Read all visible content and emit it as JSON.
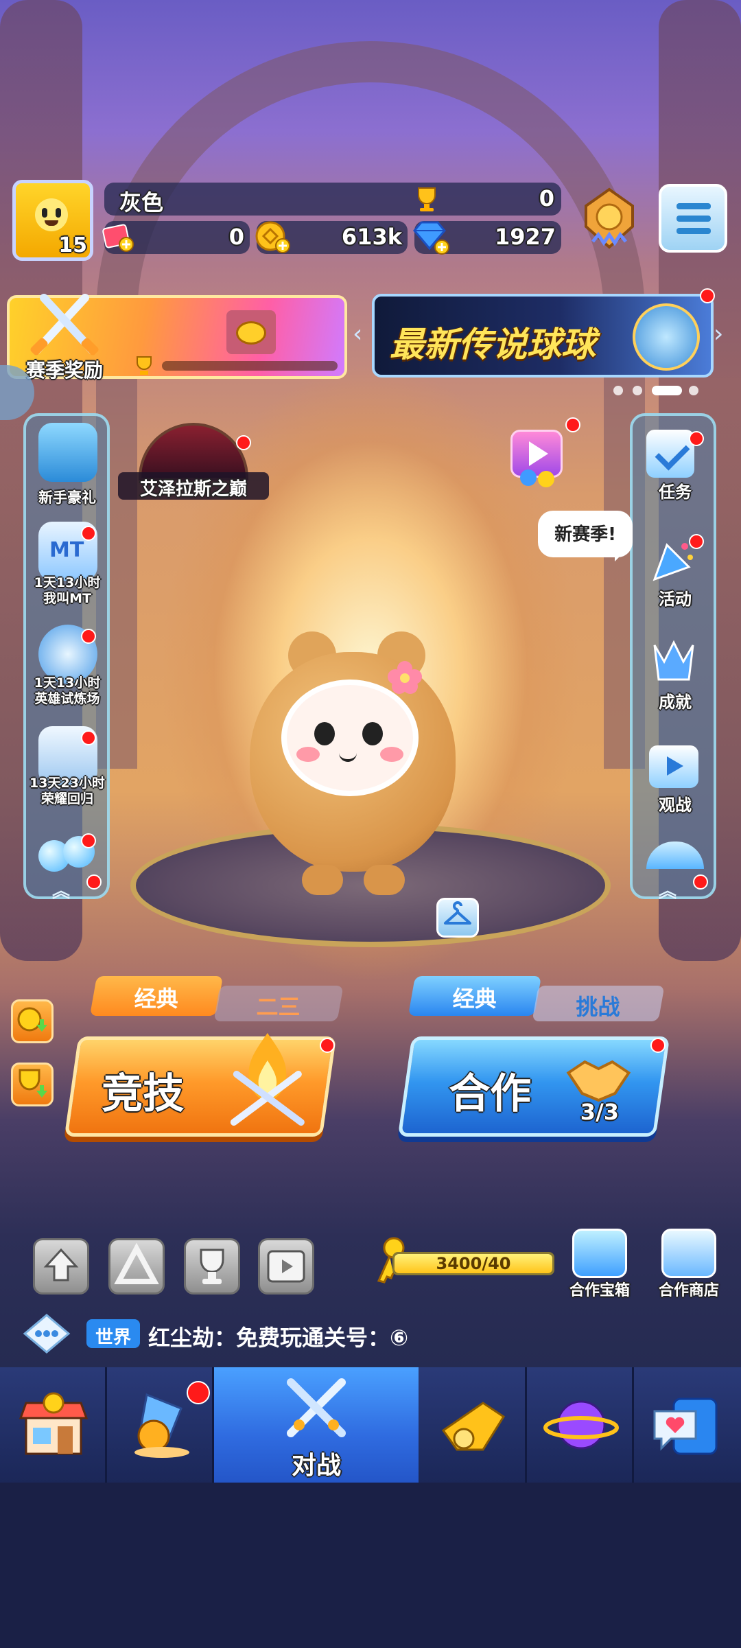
{
  "player": {
    "name": "灰色",
    "level": "15",
    "trophies": "0",
    "tickets": "0",
    "coins": "613k",
    "gems": "1927"
  },
  "banners": {
    "season_reward_label": "赛季奖励",
    "promo_title": "最新传说球球"
  },
  "left_menu": [
    {
      "label": "新手豪礼",
      "icon": "lotus-icon"
    },
    {
      "label": "1天13小时\n我叫MT",
      "icon": "mt-book-icon"
    },
    {
      "label": "1天13小时\n英雄试炼场",
      "icon": "hero-star-icon"
    },
    {
      "label": "13天23小时\n荣耀回归",
      "icon": "glory-chest-icon"
    },
    {
      "label": "",
      "icon": "bubbles-icon"
    }
  ],
  "right_menu": [
    {
      "label": "任务",
      "icon": "task-check-icon"
    },
    {
      "label": "活动",
      "icon": "party-popper-icon"
    },
    {
      "label": "成就",
      "icon": "crown-icon"
    },
    {
      "label": "观战",
      "icon": "tv-play-icon"
    }
  ],
  "event_label": "艾泽拉斯之巅",
  "speech_bubble": "新赛季!",
  "modes": {
    "left_tab_active": "经典",
    "left_tab_inactive": "二三",
    "left_button": "竞技",
    "right_tab_active": "经典",
    "right_tab_inactive": "挑战",
    "right_button": "合作",
    "coop_count": "3/3"
  },
  "progress": {
    "key_value": "3400/40",
    "coop_chest_label": "合作宝箱",
    "coop_shop_label": "合作商店"
  },
  "chat": {
    "channel": "世界",
    "message": "红尘劫：免费玩通关号：⑥"
  },
  "bottom_nav": [
    {
      "label": "",
      "icon": "shop-icon"
    },
    {
      "label": "",
      "icon": "gacha-cup-icon"
    },
    {
      "label": "对战",
      "icon": "crossed-swords-icon"
    },
    {
      "label": "",
      "icon": "whistle-icon"
    },
    {
      "label": "",
      "icon": "planet-icon"
    },
    {
      "label": "",
      "icon": "chat-heart-icon"
    }
  ],
  "colors": {
    "competitive_orange": "#ff8a1f",
    "coop_blue": "#2a86f0",
    "nav_active": "#2f6be0",
    "red_dot": "#ff1a1a"
  }
}
